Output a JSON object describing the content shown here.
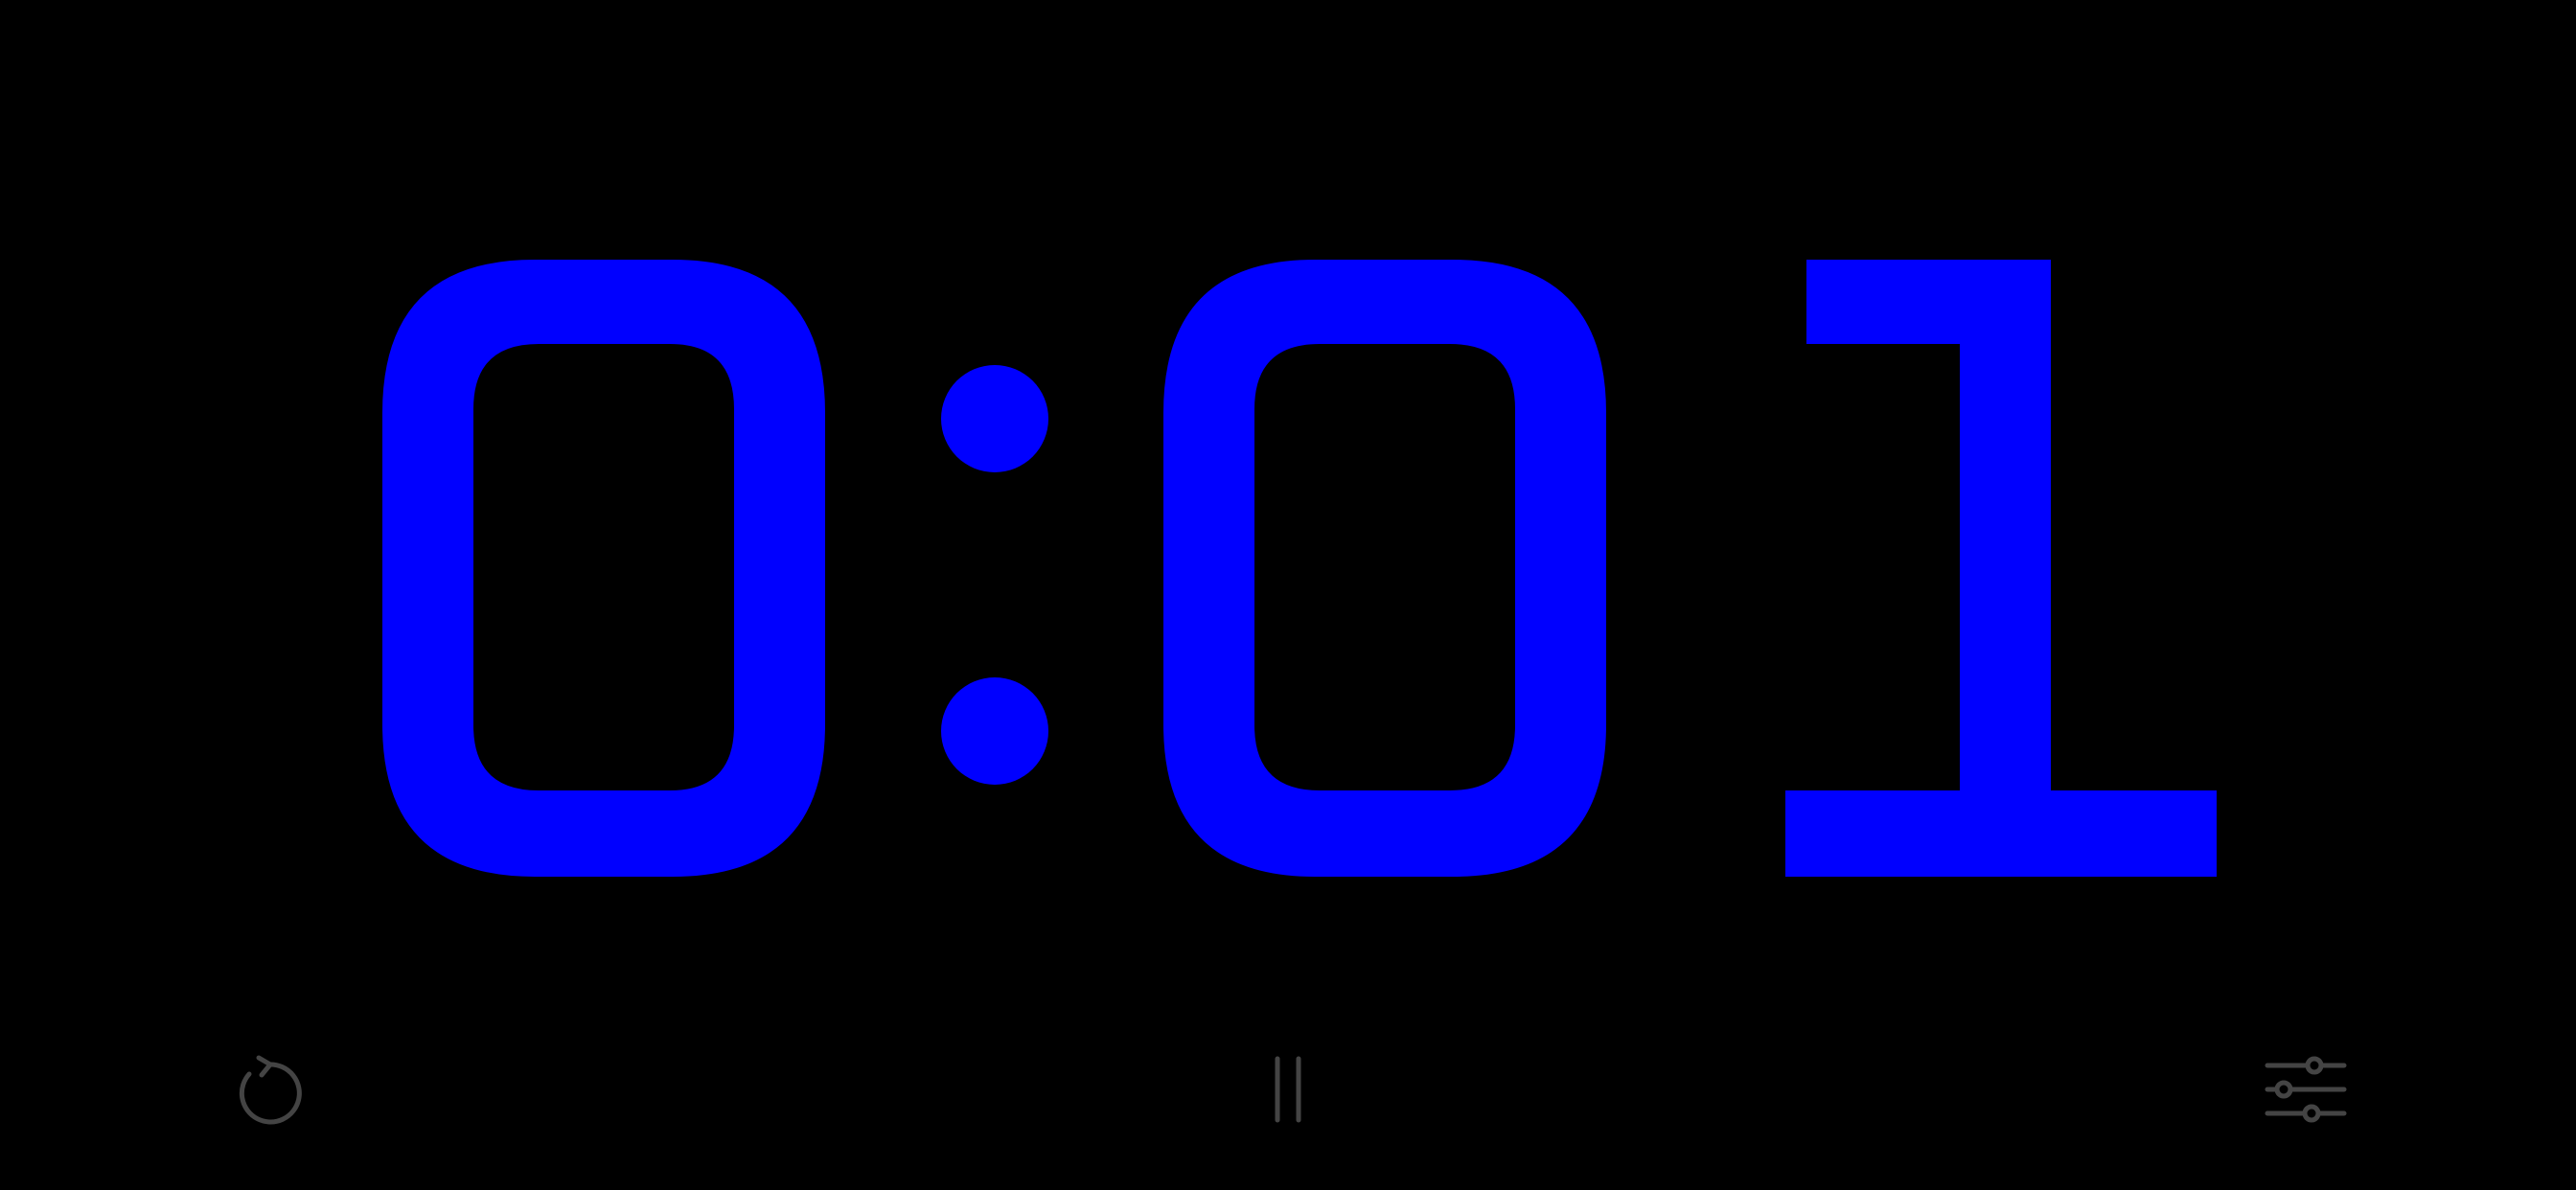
{
  "timer": {
    "display": "0:01",
    "minutes": "0",
    "separator": ":",
    "seconds_tens": "0",
    "seconds_ones": "1"
  },
  "colors": {
    "background": "#000000",
    "digits": "#0000FF",
    "controls": "#444444"
  },
  "controls": {
    "reset_icon": "reset-icon",
    "pause_icon": "pause-icon",
    "settings_icon": "sliders-icon"
  }
}
